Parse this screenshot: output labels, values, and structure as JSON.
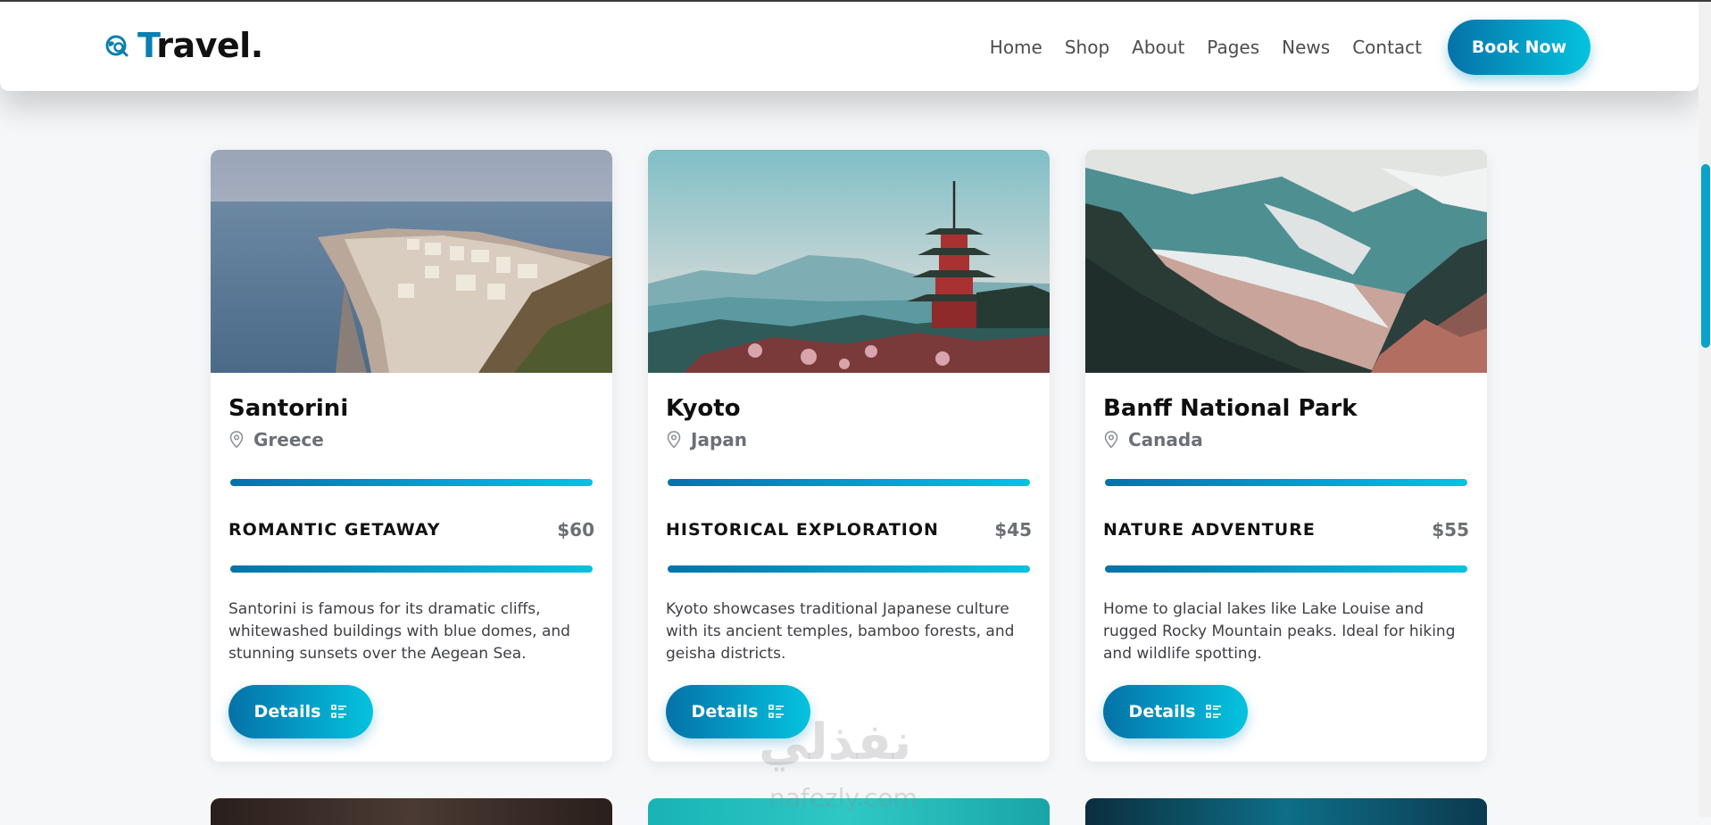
{
  "brand": {
    "initial": "T",
    "rest": "ravel",
    "dot": "."
  },
  "nav": [
    "Home",
    "Shop",
    "About",
    "Pages",
    "News",
    "Contact"
  ],
  "book_label": "Book Now",
  "cards": [
    {
      "title": "Santorini",
      "country": "Greece",
      "category": "ROMANTIC GETAWAY",
      "price": "$60",
      "description": "Santorini is famous for its dramatic cliffs, whitewashed buildings with blue domes, and stunning sunsets over the Aegean Sea.",
      "button": "Details"
    },
    {
      "title": "Kyoto",
      "country": "Japan",
      "category": "HISTORICAL EXPLORATION",
      "price": "$45",
      "description": "Kyoto showcases traditional Japanese culture with its ancient temples, bamboo forests, and geisha districts.",
      "button": "Details"
    },
    {
      "title": "Banff National Park",
      "country": "Canada",
      "category": "NATURE ADVENTURE",
      "price": "$55",
      "description": "Home to glacial lakes like Lake Louise and rugged Rocky Mountain peaks. Ideal for hiking and wildlife spotting.",
      "button": "Details"
    }
  ],
  "watermark": {
    "arabic": "نفذلي",
    "latin": "nafezly.com"
  },
  "colors": {
    "accent_start": "#0572a8",
    "accent_end": "#05c3df"
  }
}
